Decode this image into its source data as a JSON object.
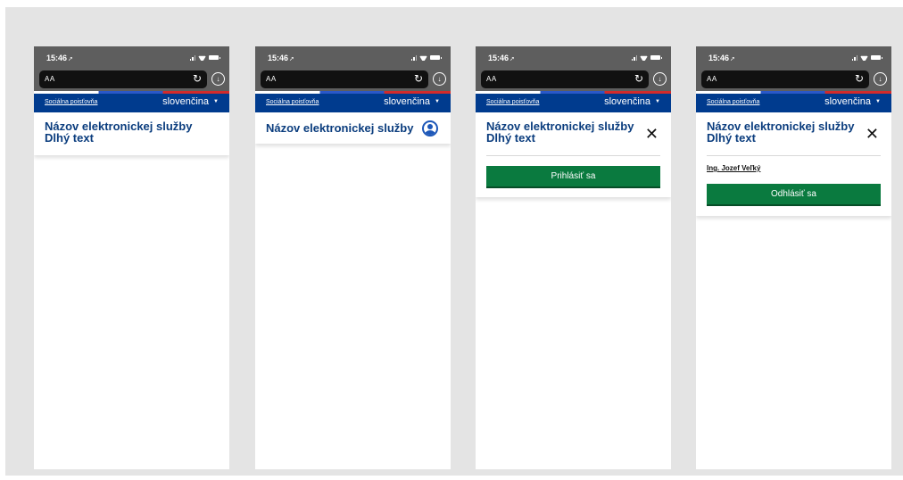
{
  "phones": [
    {
      "status_time": "15:46",
      "url_text": "AA",
      "org_link": "Sociálna poisťovňa",
      "language": "slovenčina",
      "title_line1": "Názov elektronickej služby",
      "title_line2": "Dlhý text"
    },
    {
      "status_time": "15:46",
      "url_text": "AA",
      "org_link": "Sociálna poisťovňa",
      "language": "slovenčina",
      "title_line1": "Názov elektronickej služby"
    },
    {
      "status_time": "15:46",
      "url_text": "AA",
      "org_link": "Sociálna poisťovňa",
      "language": "slovenčina",
      "title_line1": "Názov elektronickej služby",
      "title_line2": "Dlhý text",
      "close_glyph": "✕",
      "button_label": "Prihlásiť sa"
    },
    {
      "status_time": "15:46",
      "url_text": "AA",
      "org_link": "Sociálna poisťovňa",
      "language": "slovenčina",
      "title_line1": "Názov elektronickej služby",
      "title_line2": "Dlhý text",
      "close_glyph": "✕",
      "user_name": "Ing. Jozef Veľký",
      "button_label": "Odhlásiť sa"
    }
  ],
  "icons": {
    "location_arrow": "location-arrow-icon",
    "signal": "signal-icon",
    "wifi": "wifi-icon",
    "battery": "battery-icon",
    "reload": "reload-icon",
    "download": "download-icon",
    "language_caret": "caret-down-icon",
    "user": "user-account-icon",
    "close": "close-icon"
  },
  "colors": {
    "brand_blue": "#003b8e",
    "title_blue": "#0b3d7e",
    "button_green": "#0a7a3f",
    "browser_gray": "#5e5e5e",
    "canvas_gray": "#e4e4e4"
  }
}
